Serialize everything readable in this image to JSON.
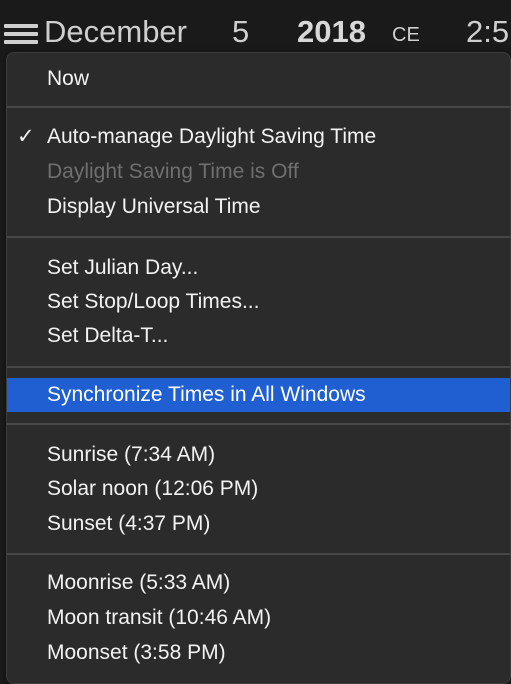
{
  "header": {
    "month": "December",
    "day": "5",
    "year": "2018",
    "era": "CE",
    "time": "2:5"
  },
  "menu": {
    "now": "Now",
    "auto_dst": "Auto-manage Daylight Saving Time",
    "auto_dst_checked": true,
    "check_mark": "✓",
    "dst_status": "Daylight Saving Time is Off",
    "display_ut": "Display Universal Time",
    "set_julian": "Set Julian Day...",
    "set_stop_loop": "Set Stop/Loop Times...",
    "set_delta_t": "Set Delta-T...",
    "sync_times": "Synchronize Times in All Windows",
    "sunrise": "Sunrise (7:34 AM)",
    "solar_noon": "Solar noon (12:06 PM)",
    "sunset": "Sunset (4:37 PM)",
    "moonrise": "Moonrise (5:33 AM)",
    "moon_transit": "Moon transit (10:46 AM)",
    "moonset": "Moonset (3:58 PM)"
  },
  "colors": {
    "highlight": "#1f5fd1",
    "menu_bg": "#2b2b2b",
    "disabled_text": "#6f6f6f"
  }
}
